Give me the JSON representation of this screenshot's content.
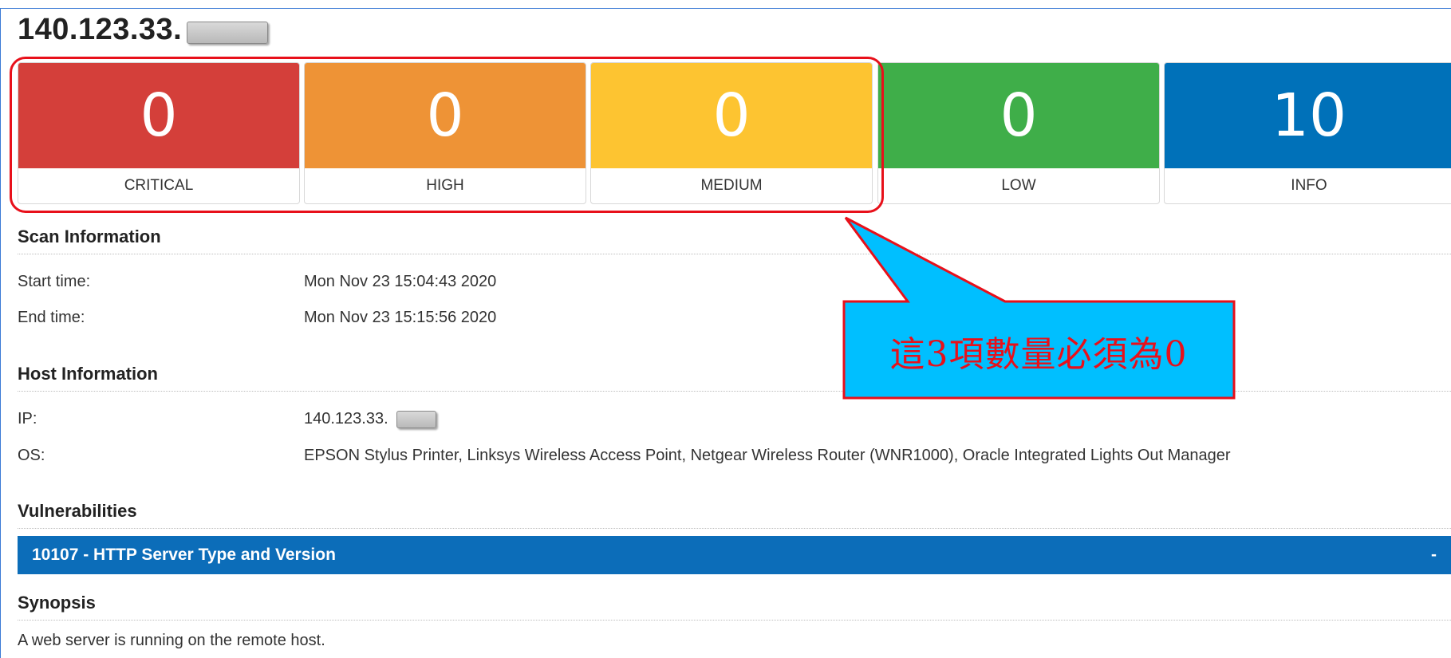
{
  "host": {
    "title": "140.123.33.",
    "ip_prefix": "140.123.33."
  },
  "severity": [
    {
      "count": "0",
      "label": "CRITICAL",
      "color": "#d43f3a"
    },
    {
      "count": "0",
      "label": "HIGH",
      "color": "#ee9336"
    },
    {
      "count": "0",
      "label": "MEDIUM",
      "color": "#fdc431"
    },
    {
      "count": "0",
      "label": "LOW",
      "color": "#3fae49"
    },
    {
      "count": "10",
      "label": "INFO",
      "color": "#0071b9"
    }
  ],
  "scan_info": {
    "title": "Scan Information",
    "start_label": "Start time:",
    "start_value": "Mon Nov 23 15:04:43 2020",
    "end_label": "End time:",
    "end_value": "Mon Nov 23 15:15:56 2020"
  },
  "host_info": {
    "title": "Host Information",
    "ip_label": "IP:",
    "ip_value": "140.123.33.",
    "os_label": "OS:",
    "os_value": "EPSON Stylus Printer, Linksys Wireless Access Point, Netgear Wireless Router (WNR1000), Oracle Integrated Lights Out Manager"
  },
  "vulnerabilities": {
    "title": "Vulnerabilities",
    "item_title": "10107 - HTTP Server Type and Version",
    "toggle": "-"
  },
  "synopsis": {
    "title": "Synopsis",
    "text": "A web server is running on the remote host."
  },
  "callout": {
    "text": "這3項數量必須為0",
    "fill_color": "#00bfff",
    "border_color": "#e8101a"
  }
}
